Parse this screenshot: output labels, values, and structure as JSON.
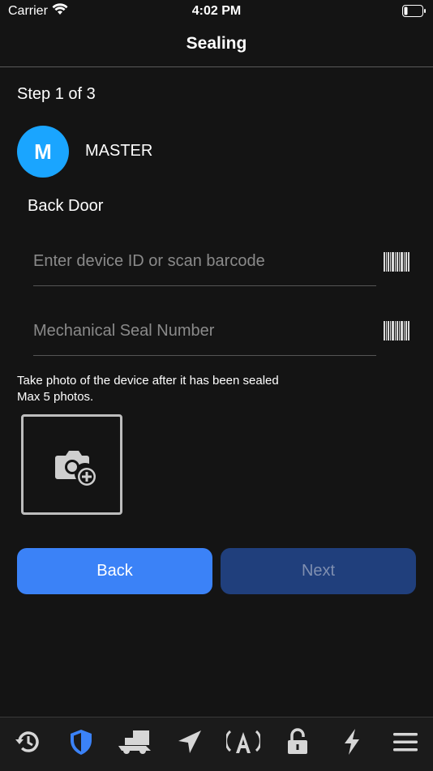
{
  "status_bar": {
    "carrier": "Carrier",
    "time": "4:02 PM"
  },
  "nav": {
    "title": "Sealing"
  },
  "step": {
    "label": "Step 1 of 3"
  },
  "master": {
    "initial": "M",
    "name": "MASTER"
  },
  "door": {
    "label": "Back Door"
  },
  "fields": {
    "device_id": {
      "placeholder": "Enter device ID or scan barcode",
      "value": ""
    },
    "seal_number": {
      "placeholder": "Mechanical Seal Number",
      "value": ""
    }
  },
  "photo": {
    "hint_line1": "Take photo of the device after it has been sealed",
    "hint_line2": "Max 5 photos."
  },
  "buttons": {
    "back": "Back",
    "next": "Next"
  },
  "colors": {
    "accent": "#3b82f7",
    "avatar": "#1aa5ff",
    "next_disabled": "#203f7c",
    "tab_active": "#3b82f7"
  },
  "tab_bar": {
    "items": [
      {
        "icon": "history-icon",
        "active": false
      },
      {
        "icon": "shield-icon",
        "active": true
      },
      {
        "icon": "dolly-icon",
        "active": false
      },
      {
        "icon": "location-arrow-icon",
        "active": false
      },
      {
        "icon": "broadcast-icon",
        "active": false
      },
      {
        "icon": "unlock-icon",
        "active": false
      },
      {
        "icon": "bolt-icon",
        "active": false
      },
      {
        "icon": "menu-icon",
        "active": false
      }
    ]
  }
}
